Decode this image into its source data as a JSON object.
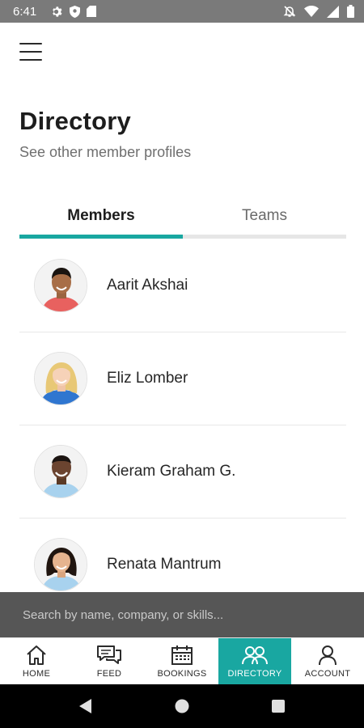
{
  "status_bar": {
    "time": "6:41"
  },
  "header": {
    "title": "Directory",
    "subtitle": "See other member profiles"
  },
  "tabs": [
    {
      "label": "Members",
      "active": true
    },
    {
      "label": "Teams",
      "active": false
    }
  ],
  "members": [
    {
      "name": "Aarit Akshai"
    },
    {
      "name": "Eliz Lomber"
    },
    {
      "name": "Kieram Graham G."
    },
    {
      "name": "Renata Mantrum"
    }
  ],
  "search": {
    "placeholder": "Search by name, company, or skills..."
  },
  "bottom_nav": [
    {
      "label": "HOME",
      "icon": "home-icon"
    },
    {
      "label": "FEED",
      "icon": "chat-icon"
    },
    {
      "label": "BOOKINGS",
      "icon": "calendar-icon"
    },
    {
      "label": "DIRECTORY",
      "icon": "people-icon",
      "active": true
    },
    {
      "label": "ACCOUNT",
      "icon": "person-icon"
    }
  ],
  "colors": {
    "accent": "#19a7a1",
    "status_bar": "#7a7a7a",
    "search_bar": "#565656"
  }
}
